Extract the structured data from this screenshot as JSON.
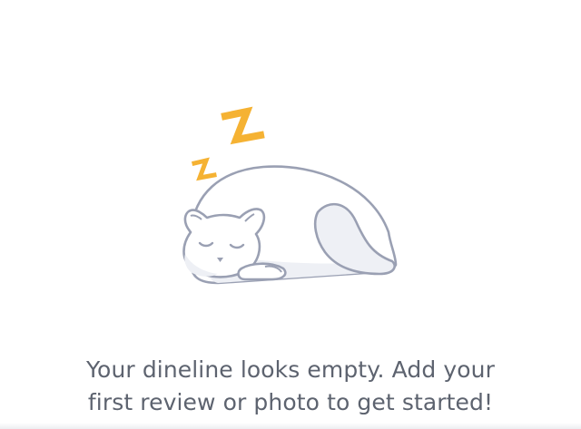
{
  "empty_state": {
    "illustration": {
      "icon": "sleeping-cat-icon",
      "zzz_color": "#f5b233",
      "outline_color": "#9aa0b3",
      "fill_color": "#ffffff"
    },
    "message_line_1": "Your dineline looks empty. Add your",
    "message_line_2": "first review or photo to get started!",
    "text_color": "#5d636f"
  }
}
